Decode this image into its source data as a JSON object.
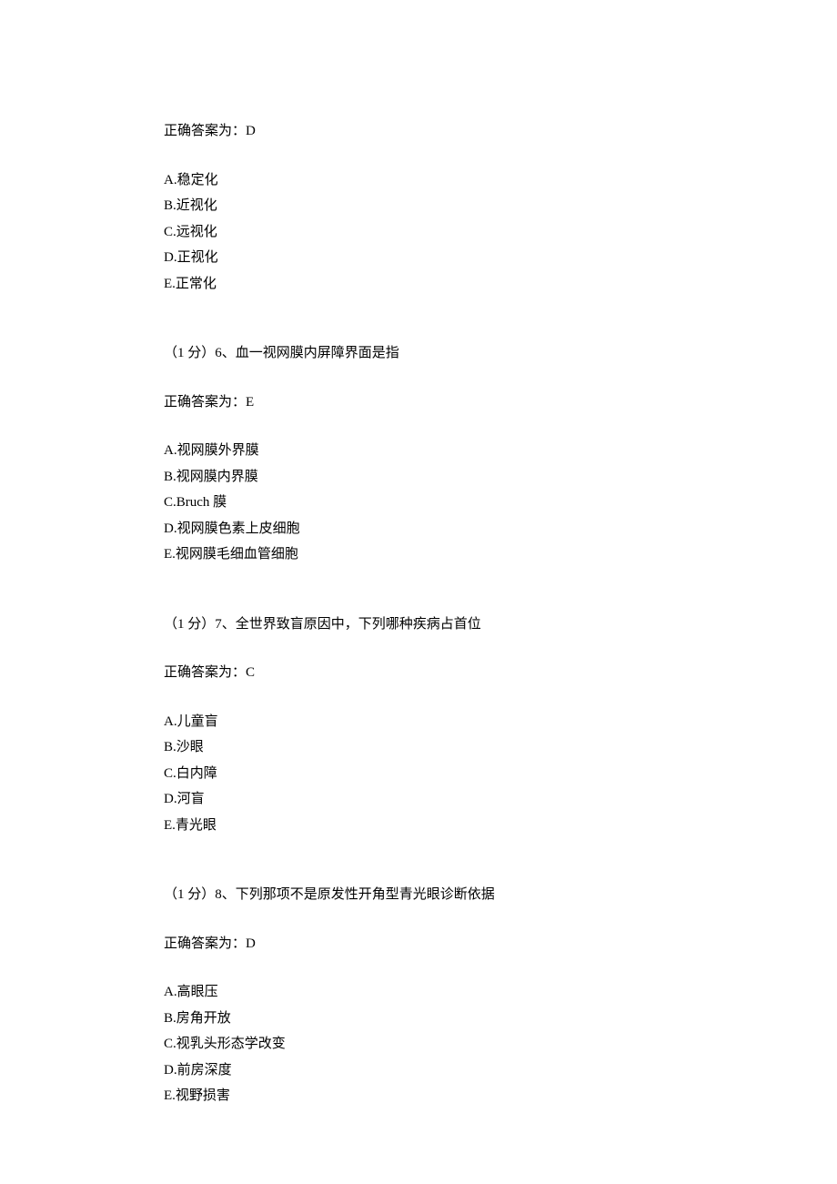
{
  "blocks": [
    {
      "answer_label": "正确答案为：D",
      "options": [
        "A.稳定化",
        "B.近视化",
        "C.远视化",
        "D.正视化",
        "E.正常化"
      ]
    },
    {
      "question": "（1 分）6、血一视网膜内屏障界面是指",
      "answer_label": "正确答案为：E",
      "options": [
        "A.视网膜外界膜",
        "B.视网膜内界膜",
        "C.Bruch 膜",
        "D.视网膜色素上皮细胞",
        "E.视网膜毛细血管细胞"
      ]
    },
    {
      "question": "（1 分）7、全世界致盲原因中，下列哪种疾病占首位",
      "answer_label": "正确答案为：C",
      "options": [
        "A.儿童盲",
        "B.沙眼",
        "C.白内障",
        "D.河盲",
        "E.青光眼"
      ]
    },
    {
      "question": "（1 分）8、下列那项不是原发性开角型青光眼诊断依据",
      "answer_label": "正确答案为：D",
      "options": [
        "A.高眼压",
        "B.房角开放",
        "C.视乳头形态学改变",
        "D.前房深度",
        "E.视野损害"
      ]
    }
  ]
}
